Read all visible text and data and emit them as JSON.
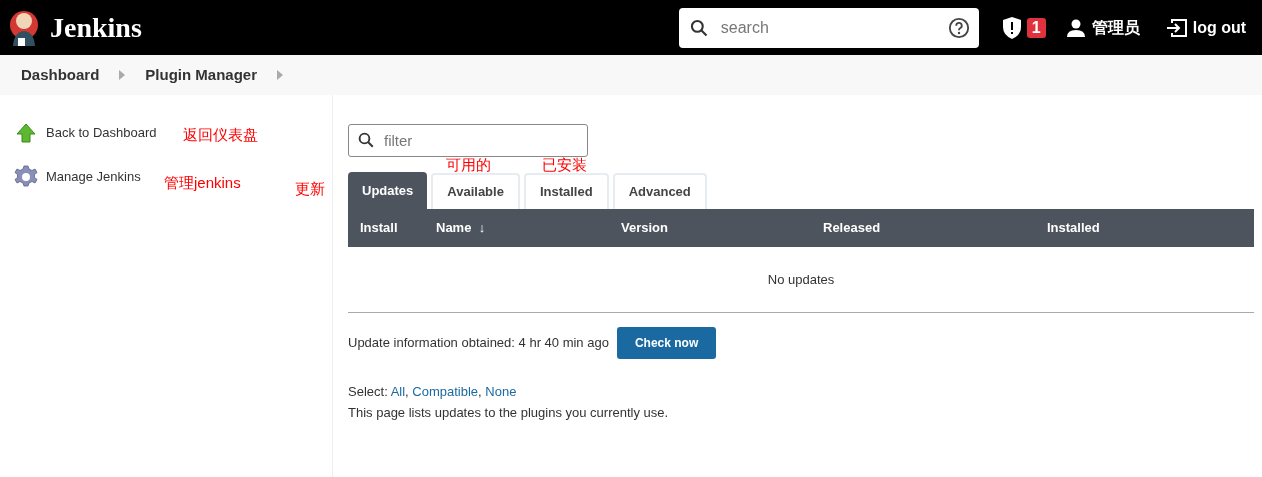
{
  "header": {
    "brand": "Jenkins",
    "search": {
      "placeholder": "search"
    },
    "alert_count": "1",
    "user": "管理员",
    "logout": "log out"
  },
  "breadcrumbs": [
    "Dashboard",
    "Plugin Manager"
  ],
  "sidebar": {
    "items": [
      {
        "label": "Back to Dashboard",
        "kind": "up"
      },
      {
        "label": "Manage Jenkins",
        "kind": "gear"
      }
    ]
  },
  "filter": {
    "placeholder": "filter"
  },
  "tabs": [
    {
      "label": "Updates",
      "selected": true
    },
    {
      "label": "Available",
      "selected": false
    },
    {
      "label": "Installed",
      "selected": false
    },
    {
      "label": "Advanced",
      "selected": false
    }
  ],
  "table": {
    "columns": [
      {
        "label": "Install"
      },
      {
        "label": "Name",
        "sort": "↓"
      },
      {
        "label": "Version"
      },
      {
        "label": "Released"
      },
      {
        "label": "Installed"
      }
    ],
    "empty": "No updates"
  },
  "update_info": "Update information obtained: 4 hr 40 min ago",
  "check_button": "Check now",
  "select": {
    "label": "Select:",
    "separator": ",",
    "links": [
      "All",
      "Compatible",
      "None"
    ]
  },
  "description": "This page lists updates to the plugins you currently use.",
  "annotations": [
    {
      "text": "返回仪表盘"
    },
    {
      "text": "管理jenkins"
    },
    {
      "text": "更新"
    },
    {
      "text": "可用的"
    },
    {
      "text": "已安装"
    }
  ]
}
